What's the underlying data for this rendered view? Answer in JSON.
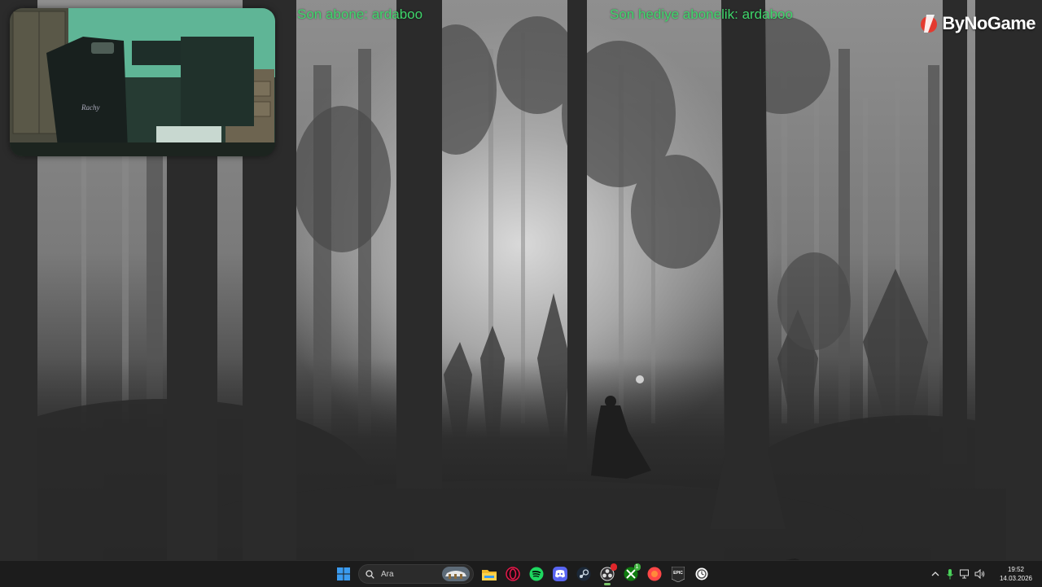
{
  "overlay": {
    "last_sub_label": "Son abone: ardaboo",
    "last_gift_label": "Son hediye abonelik: ardaboo",
    "brand": "ByNoGame",
    "text_color": "#3fd66b"
  },
  "webcam": {
    "chair_text": "Rachy"
  },
  "taskbar": {
    "search_placeholder": "Ara",
    "apps": [
      {
        "name": "file-explorer-icon"
      },
      {
        "name": "opera-gx-icon"
      },
      {
        "name": "spotify-icon"
      },
      {
        "name": "discord-icon"
      },
      {
        "name": "steam-icon"
      },
      {
        "name": "obs-icon",
        "badge": ""
      },
      {
        "name": "xbox-icon",
        "badge": "1"
      },
      {
        "name": "ea-app-icon"
      },
      {
        "name": "epic-games-icon"
      },
      {
        "name": "clock-app-icon"
      }
    ],
    "epic_text": "EPIC",
    "clock_time": "19:52",
    "clock_date": "14.03.2026"
  },
  "colors": {
    "taskbar_bg": "#1c1c1c",
    "accent_green": "#3fd66b",
    "windows_blue": "#3a9bf0"
  }
}
